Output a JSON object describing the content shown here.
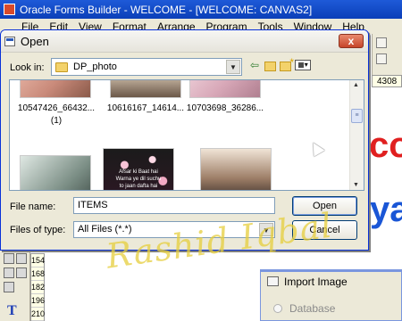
{
  "app": {
    "title": "Oracle Forms Builder - WELCOME - [WELCOME: CANVAS2]",
    "menu": [
      "File",
      "Edit",
      "View",
      "Format",
      "Arrange",
      "Program",
      "Tools",
      "Window",
      "Help"
    ],
    "ruler_value": "4308",
    "row_numbers": [
      "154",
      "168",
      "182",
      "196",
      "210"
    ]
  },
  "open_dialog": {
    "title": "Open",
    "close_label": "x",
    "look_in_label": "Look in:",
    "look_in_value": "DP_photo",
    "files": [
      {
        "name": "10547426_66432...",
        "extra": "(1)"
      },
      {
        "name": "10616167_14614...",
        "extra": ""
      },
      {
        "name": "10703698_36286...",
        "extra": ""
      }
    ],
    "bottom_thumb_text": "Afsar ki Baat hai\nWarna ye dil suchu\nto jaan dafta hai\nwo bol",
    "file_name_label": "File name:",
    "file_name_value": "ITEMS",
    "files_of_type_label": "Files of type:",
    "files_of_type_value": "All Files (*.*)",
    "open_button": "Open",
    "cancel_button": "Cancel"
  },
  "import_dialog": {
    "title": "Import Image",
    "database_label": "Database"
  },
  "watermark": "Rashid Iqbal",
  "colors": {
    "titlebar": "#0b3fb8",
    "dialog_bg": "#ece9d8",
    "canvas_red": "#e02020",
    "canvas_blue": "#1a56d6"
  }
}
